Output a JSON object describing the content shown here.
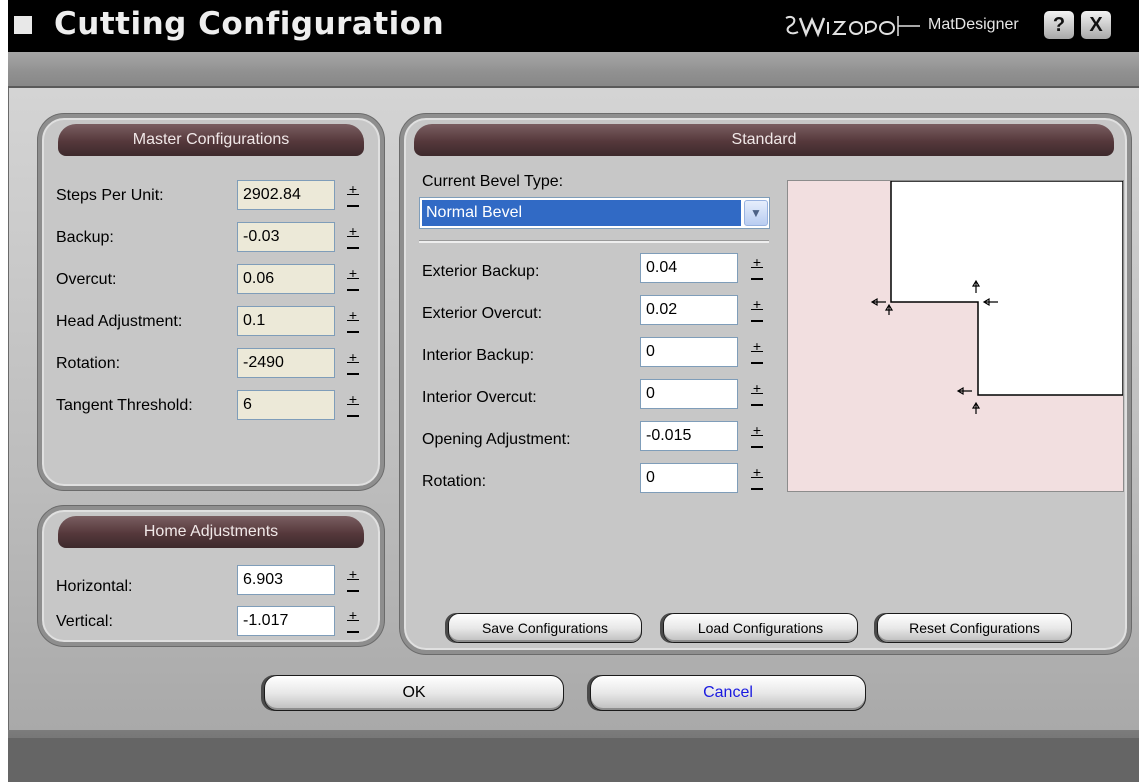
{
  "window": {
    "title": "Cutting Configuration",
    "brand": "MatDesigner",
    "help_label": "?",
    "close_label": "X"
  },
  "master": {
    "title": "Master Configurations",
    "rows": [
      {
        "label": "Steps Per Unit:",
        "value": "2902.84"
      },
      {
        "label": "Backup:",
        "value": "-0.03"
      },
      {
        "label": "Overcut:",
        "value": "0.06"
      },
      {
        "label": "Head Adjustment:",
        "value": "0.1"
      },
      {
        "label": "Rotation:",
        "value": "-2490"
      },
      {
        "label": "Tangent Threshold:",
        "value": "6"
      }
    ]
  },
  "home": {
    "title": "Home Adjustments",
    "rows": [
      {
        "label": "Horizontal:",
        "value": "6.903"
      },
      {
        "label": "Vertical:",
        "value": "-1.017"
      }
    ]
  },
  "standard": {
    "title": "Standard",
    "bevel_label": "Current Bevel Type:",
    "bevel_value": "Normal Bevel",
    "rows": [
      {
        "label": "Exterior Backup:",
        "value": "0.04"
      },
      {
        "label": "Exterior Overcut:",
        "value": "0.02"
      },
      {
        "label": "Interior Backup:",
        "value": "0"
      },
      {
        "label": "Interior Overcut:",
        "value": "0"
      },
      {
        "label": "Opening Adjustment:",
        "value": "-0.015"
      },
      {
        "label": "Rotation:",
        "value": "0"
      }
    ],
    "buttons": {
      "save": "Save Configurations",
      "load": "Load Configurations",
      "reset": "Reset Configurations"
    }
  },
  "footer": {
    "ok": "OK",
    "cancel": "Cancel"
  },
  "colors": {
    "panel_header": "#55383b",
    "preview_fill": "#f2dfe0",
    "selection": "#316ac5",
    "cancel_text": "#1a1ae0"
  }
}
